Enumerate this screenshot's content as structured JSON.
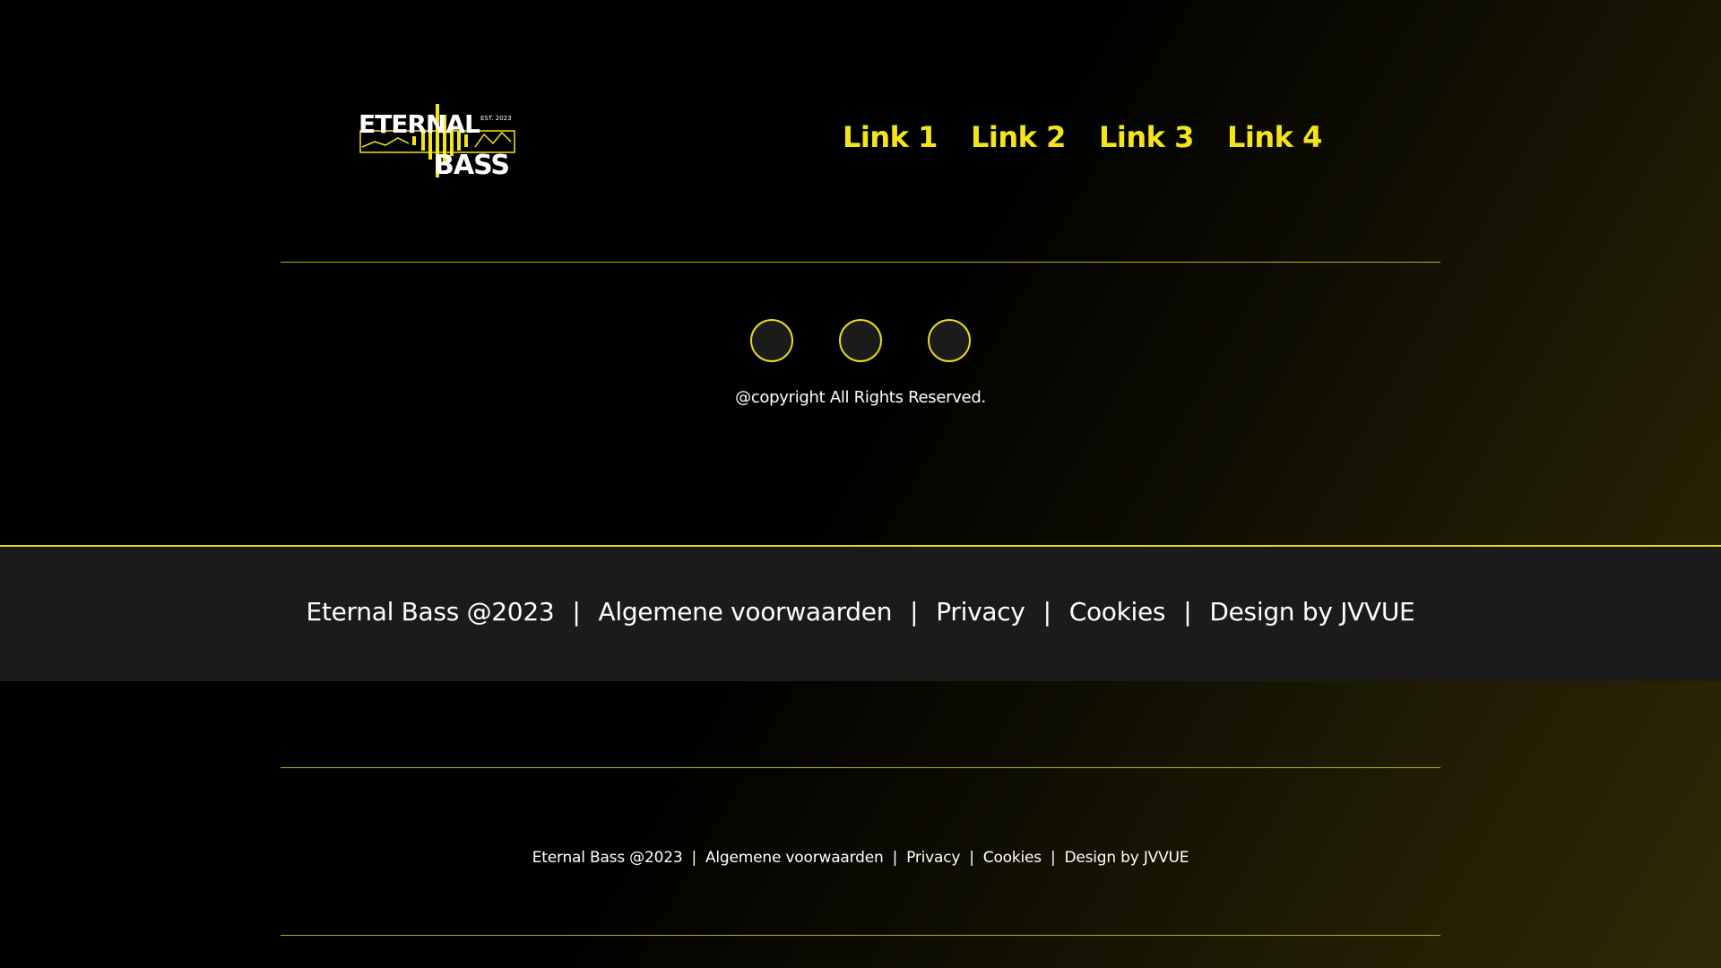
{
  "brand": {
    "logo_line1": "ETERNAL",
    "logo_line2": "BASS",
    "logo_tag": "EST. 2023",
    "accent_color": "#f2e51c"
  },
  "nav": {
    "links": [
      "Link 1",
      "Link 2",
      "Link 3",
      "Link 4"
    ]
  },
  "socials": {
    "icons": [
      "social-icon-1",
      "social-icon-2",
      "social-icon-3"
    ]
  },
  "copyright": "@copyright All Rights Reserved.",
  "band": {
    "items": [
      "Eternal Bass @2023",
      "Algemene voorwaarden",
      "Privacy",
      "Cookies",
      "Design by JVVUE"
    ],
    "separator": "|"
  },
  "footer": {
    "items": [
      "Eternal Bass @2023",
      "Algemene voorwaarden",
      "Privacy",
      "Cookies",
      "Design by JVVUE"
    ],
    "separator": "|"
  }
}
